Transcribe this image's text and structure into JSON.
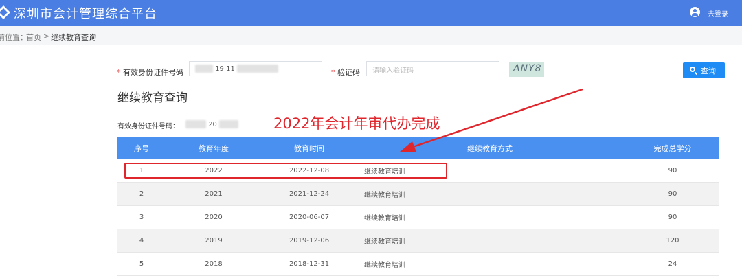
{
  "header": {
    "title": "深圳市会计管理综合平台",
    "login_label": "去登录"
  },
  "breadcrumb": {
    "prefix": "前位置：",
    "home": "首页",
    "separator": ">",
    "current": "继续教育查询"
  },
  "form": {
    "required_mark": "*",
    "id_label": "有效身份证件号码",
    "id_value": "19 11",
    "code_label": "验证码",
    "code_placeholder": "请输入验证码",
    "captcha_text": "ANY8",
    "search_label": "查询"
  },
  "section": {
    "title": "继续教育查询",
    "id_line_label": "有效身份证件号码：",
    "id_line_value": "20"
  },
  "annotation": {
    "text": "2022年会计年审代办完成",
    "color": "#e0262d"
  },
  "table": {
    "headers": [
      "序号",
      "教育年度",
      "教育时间",
      "继续教育方式",
      "完成总学分"
    ],
    "rows": [
      {
        "no": "1",
        "year": "2022",
        "date": "2022-12-08",
        "method": "继续教育培训",
        "credits": "90"
      },
      {
        "no": "2",
        "year": "2021",
        "date": "2021-12-24",
        "method": "继续教育培训",
        "credits": "90"
      },
      {
        "no": "3",
        "year": "2020",
        "date": "2020-06-07",
        "method": "继续教育培训",
        "credits": "90"
      },
      {
        "no": "4",
        "year": "2019",
        "date": "2019-12-06",
        "method": "继续教育培训",
        "credits": "120"
      },
      {
        "no": "5",
        "year": "2018",
        "date": "2018-12-31",
        "method": "继续教育培训",
        "credits": "24"
      }
    ]
  },
  "colors": {
    "header_bg": "#4a7ee3",
    "table_header_bg": "#4a90f0",
    "button_bg": "#1f8bf5",
    "highlight": "#e0262d"
  }
}
